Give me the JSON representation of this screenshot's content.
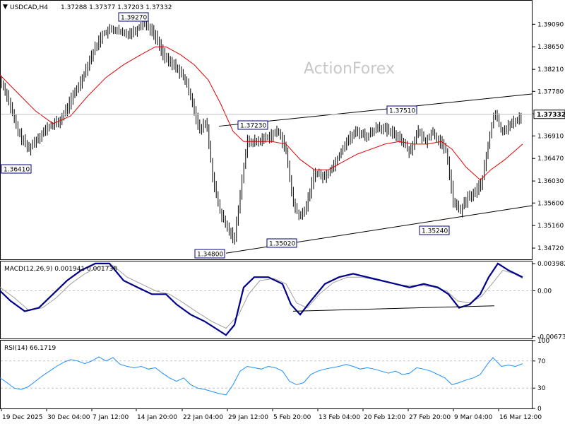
{
  "header": {
    "symbol": "USDCAD,H4",
    "ohlc": "1.37288 1.37377 1.37203 1.37332"
  },
  "watermark": "ActionForex",
  "colors": {
    "price_bar": "#000000",
    "ma": "#e00000",
    "trendline": "#000000",
    "macd": "#00008b",
    "macd_signal": "#a0a0a0",
    "rsi": "#1e90ff",
    "grid": "#c0c0c0"
  },
  "chart_data": [
    {
      "type": "candlestick",
      "series_label": "USDCAD,H4",
      "ylim": [
        1.345,
        1.3955
      ],
      "y_ticks": [
        "1.39090",
        "1.38650",
        "1.38210",
        "1.37780",
        "1.37340",
        "1.36910",
        "1.36470",
        "1.36030",
        "1.35600",
        "1.35160",
        "1.34720"
      ],
      "last_price": "1.37332",
      "swing_labels": [
        "1.39270",
        "1.37230",
        "1.37510",
        "1.36410",
        "1.34800",
        "1.35020",
        "1.35240"
      ],
      "close_path": [
        [
          0,
          1.38
        ],
        [
          10,
          1.377
        ],
        [
          25,
          1.37
        ],
        [
          40,
          1.3665
        ],
        [
          55,
          1.369
        ],
        [
          70,
          1.371
        ],
        [
          85,
          1.372
        ],
        [
          100,
          1.376
        ],
        [
          115,
          1.38
        ],
        [
          130,
          1.385
        ],
        [
          145,
          1.389
        ],
        [
          160,
          1.39
        ],
        [
          175,
          1.389
        ],
        [
          190,
          1.3895
        ],
        [
          205,
          1.3915
        ],
        [
          220,
          1.3885
        ],
        [
          235,
          1.384
        ],
        [
          250,
          1.3825
        ],
        [
          262,
          1.38
        ],
        [
          272,
          1.376
        ],
        [
          282,
          1.37
        ],
        [
          292,
          1.372
        ],
        [
          302,
          1.36
        ],
        [
          312,
          1.354
        ],
        [
          322,
          1.351
        ],
        [
          332,
          1.349
        ],
        [
          340,
          1.358
        ],
        [
          350,
          1.368
        ],
        [
          365,
          1.368
        ],
        [
          380,
          1.369
        ],
        [
          395,
          1.37
        ],
        [
          405,
          1.366
        ],
        [
          415,
          1.356
        ],
        [
          425,
          1.353
        ],
        [
          435,
          1.356
        ],
        [
          445,
          1.362
        ],
        [
          460,
          1.361
        ],
        [
          475,
          1.364
        ],
        [
          490,
          1.368
        ],
        [
          505,
          1.37
        ],
        [
          520,
          1.369
        ],
        [
          535,
          1.371
        ],
        [
          550,
          1.37
        ],
        [
          565,
          1.369
        ],
        [
          580,
          1.366
        ],
        [
          592,
          1.37
        ],
        [
          602,
          1.368
        ],
        [
          612,
          1.37
        ],
        [
          622,
          1.368
        ],
        [
          632,
          1.366
        ],
        [
          642,
          1.356
        ],
        [
          652,
          1.3545
        ],
        [
          662,
          1.357
        ],
        [
          672,
          1.358
        ],
        [
          682,
          1.36
        ],
        [
          692,
          1.368
        ],
        [
          700,
          1.374
        ],
        [
          710,
          1.37
        ],
        [
          720,
          1.371
        ],
        [
          730,
          1.372
        ],
        [
          740,
          1.3733
        ]
      ],
      "ma_path": [
        [
          0,
          1.381
        ],
        [
          25,
          1.3775
        ],
        [
          50,
          1.374
        ],
        [
          75,
          1.3715
        ],
        [
          100,
          1.373
        ],
        [
          125,
          1.377
        ],
        [
          150,
          1.3805
        ],
        [
          175,
          1.383
        ],
        [
          200,
          1.385
        ],
        [
          220,
          1.3865
        ],
        [
          235,
          1.3865
        ],
        [
          255,
          1.385
        ],
        [
          275,
          1.383
        ],
        [
          295,
          1.38
        ],
        [
          312,
          1.3755
        ],
        [
          330,
          1.37
        ],
        [
          345,
          1.368
        ],
        [
          365,
          1.368
        ],
        [
          385,
          1.368
        ],
        [
          405,
          1.3675
        ],
        [
          425,
          1.3645
        ],
        [
          445,
          1.3625
        ],
        [
          465,
          1.3625
        ],
        [
          485,
          1.364
        ],
        [
          505,
          1.3655
        ],
        [
          525,
          1.3665
        ],
        [
          545,
          1.3675
        ],
        [
          565,
          1.368
        ],
        [
          585,
          1.3675
        ],
        [
          605,
          1.3675
        ],
        [
          625,
          1.368
        ],
        [
          640,
          1.3665
        ],
        [
          660,
          1.363
        ],
        [
          680,
          1.3605
        ],
        [
          695,
          1.3625
        ],
        [
          715,
          1.3645
        ],
        [
          740,
          1.3675
        ]
      ],
      "trendlines": [
        {
          "name": "upper-channel",
          "points": [
            [
              310,
              1.371
            ],
            [
              800,
              1.3773
            ]
          ]
        },
        {
          "name": "lower-channel",
          "points": [
            [
              320,
              1.3462
            ],
            [
              755,
              1.3555
            ]
          ]
        }
      ]
    },
    {
      "type": "line",
      "indicator": "MACD",
      "label": "MACD(12,26,9) 0.001941 0.001738",
      "ylim": [
        -0.007,
        0.0043
      ],
      "y_ticks": [
        "0.003982",
        "0.00",
        "-0.006737"
      ],
      "macd_path": [
        [
          0,
          0.0
        ],
        [
          15,
          -0.0015
        ],
        [
          35,
          -0.003
        ],
        [
          55,
          -0.0025
        ],
        [
          75,
          -0.0005
        ],
        [
          95,
          0.0015
        ],
        [
          115,
          0.003
        ],
        [
          135,
          0.004
        ],
        [
          155,
          0.004
        ],
        [
          175,
          0.0015
        ],
        [
          195,
          0.0005
        ],
        [
          215,
          -0.0005
        ],
        [
          235,
          -0.0005
        ],
        [
          250,
          -0.002
        ],
        [
          270,
          -0.0035
        ],
        [
          290,
          -0.0045
        ],
        [
          305,
          -0.0055
        ],
        [
          320,
          -0.0065
        ],
        [
          332,
          -0.005
        ],
        [
          345,
          0.0005
        ],
        [
          360,
          0.002
        ],
        [
          380,
          0.002
        ],
        [
          400,
          0.001
        ],
        [
          412,
          -0.002
        ],
        [
          425,
          -0.0035
        ],
        [
          440,
          -0.0015
        ],
        [
          460,
          0.001
        ],
        [
          480,
          0.002
        ],
        [
          500,
          0.0025
        ],
        [
          520,
          0.002
        ],
        [
          540,
          0.0015
        ],
        [
          560,
          0.001
        ],
        [
          580,
          0.0005
        ],
        [
          600,
          0.001
        ],
        [
          620,
          0.0005
        ],
        [
          635,
          -0.0005
        ],
        [
          650,
          -0.0025
        ],
        [
          665,
          -0.002
        ],
        [
          680,
          -0.0005
        ],
        [
          692,
          0.002
        ],
        [
          705,
          0.004
        ],
        [
          720,
          0.003
        ],
        [
          740,
          0.002
        ]
      ],
      "signal_path": [
        [
          0,
          0.0005
        ],
        [
          20,
          -0.001
        ],
        [
          40,
          -0.0028
        ],
        [
          60,
          -0.0025
        ],
        [
          80,
          -0.001
        ],
        [
          100,
          0.001
        ],
        [
          120,
          0.0025
        ],
        [
          140,
          0.0035
        ],
        [
          160,
          0.0037
        ],
        [
          180,
          0.002
        ],
        [
          200,
          0.001
        ],
        [
          220,
          0.0
        ],
        [
          240,
          -0.0005
        ],
        [
          260,
          -0.0018
        ],
        [
          280,
          -0.0032
        ],
        [
          300,
          -0.0045
        ],
        [
          320,
          -0.0055
        ],
        [
          338,
          -0.0035
        ],
        [
          352,
          -0.0005
        ],
        [
          368,
          0.0015
        ],
        [
          388,
          0.0018
        ],
        [
          405,
          0.001
        ],
        [
          420,
          -0.0018
        ],
        [
          435,
          -0.0025
        ],
        [
          452,
          -0.0005
        ],
        [
          472,
          0.0012
        ],
        [
          492,
          0.002
        ],
        [
          512,
          0.002
        ],
        [
          532,
          0.0016
        ],
        [
          552,
          0.0012
        ],
        [
          572,
          0.0008
        ],
        [
          592,
          0.0008
        ],
        [
          612,
          0.0006
        ],
        [
          632,
          0.0
        ],
        [
          648,
          -0.0015
        ],
        [
          665,
          -0.0018
        ],
        [
          682,
          -0.0008
        ],
        [
          698,
          0.0012
        ],
        [
          712,
          0.003
        ],
        [
          728,
          0.0025
        ],
        [
          740,
          0.0018
        ]
      ],
      "trendline": [
        [
          415,
          -0.003
        ],
        [
          700,
          -0.0022
        ]
      ]
    },
    {
      "type": "line",
      "indicator": "RSI",
      "label": "RSI(14) 66.1719",
      "ylim": [
        0,
        100
      ],
      "y_ticks": [
        "100",
        "70",
        "30",
        "0"
      ],
      "levels": [
        70,
        30
      ],
      "rsi_path": [
        [
          0,
          45
        ],
        [
          10,
          38
        ],
        [
          20,
          30
        ],
        [
          30,
          28
        ],
        [
          40,
          32
        ],
        [
          50,
          40
        ],
        [
          60,
          48
        ],
        [
          70,
          55
        ],
        [
          80,
          62
        ],
        [
          90,
          68
        ],
        [
          100,
          72
        ],
        [
          110,
          70
        ],
        [
          120,
          66
        ],
        [
          130,
          70
        ],
        [
          140,
          76
        ],
        [
          150,
          70
        ],
        [
          160,
          75
        ],
        [
          170,
          65
        ],
        [
          180,
          62
        ],
        [
          190,
          60
        ],
        [
          200,
          62
        ],
        [
          210,
          58
        ],
        [
          220,
          60
        ],
        [
          230,
          52
        ],
        [
          240,
          45
        ],
        [
          250,
          40
        ],
        [
          260,
          45
        ],
        [
          270,
          35
        ],
        [
          280,
          30
        ],
        [
          290,
          28
        ],
        [
          300,
          25
        ],
        [
          310,
          22
        ],
        [
          320,
          20
        ],
        [
          330,
          35
        ],
        [
          340,
          55
        ],
        [
          350,
          62
        ],
        [
          360,
          60
        ],
        [
          370,
          58
        ],
        [
          380,
          62
        ],
        [
          390,
          60
        ],
        [
          400,
          55
        ],
        [
          410,
          40
        ],
        [
          420,
          35
        ],
        [
          430,
          38
        ],
        [
          440,
          50
        ],
        [
          450,
          55
        ],
        [
          460,
          58
        ],
        [
          470,
          60
        ],
        [
          480,
          62
        ],
        [
          490,
          65
        ],
        [
          500,
          62
        ],
        [
          510,
          58
        ],
        [
          520,
          60
        ],
        [
          530,
          58
        ],
        [
          540,
          55
        ],
        [
          550,
          52
        ],
        [
          560,
          55
        ],
        [
          570,
          50
        ],
        [
          580,
          52
        ],
        [
          590,
          60
        ],
        [
          600,
          58
        ],
        [
          610,
          55
        ],
        [
          620,
          50
        ],
        [
          630,
          45
        ],
        [
          640,
          35
        ],
        [
          650,
          38
        ],
        [
          660,
          42
        ],
        [
          670,
          45
        ],
        [
          680,
          50
        ],
        [
          690,
          65
        ],
        [
          698,
          75
        ],
        [
          710,
          62
        ],
        [
          720,
          64
        ],
        [
          730,
          62
        ],
        [
          740,
          66
        ]
      ]
    }
  ],
  "x_axis": {
    "labels": [
      "19 Dec 2025",
      "30 Dec 04:00",
      "7 Jan 12:00",
      "14 Jan 20:00",
      "22 Jan 04:00",
      "29 Jan 12:00",
      "5 Feb 20:00",
      "13 Feb 04:00",
      "20 Feb 12:00",
      "27 Feb 20:00",
      "9 Mar 04:00",
      "16 Mar 12:00"
    ]
  }
}
